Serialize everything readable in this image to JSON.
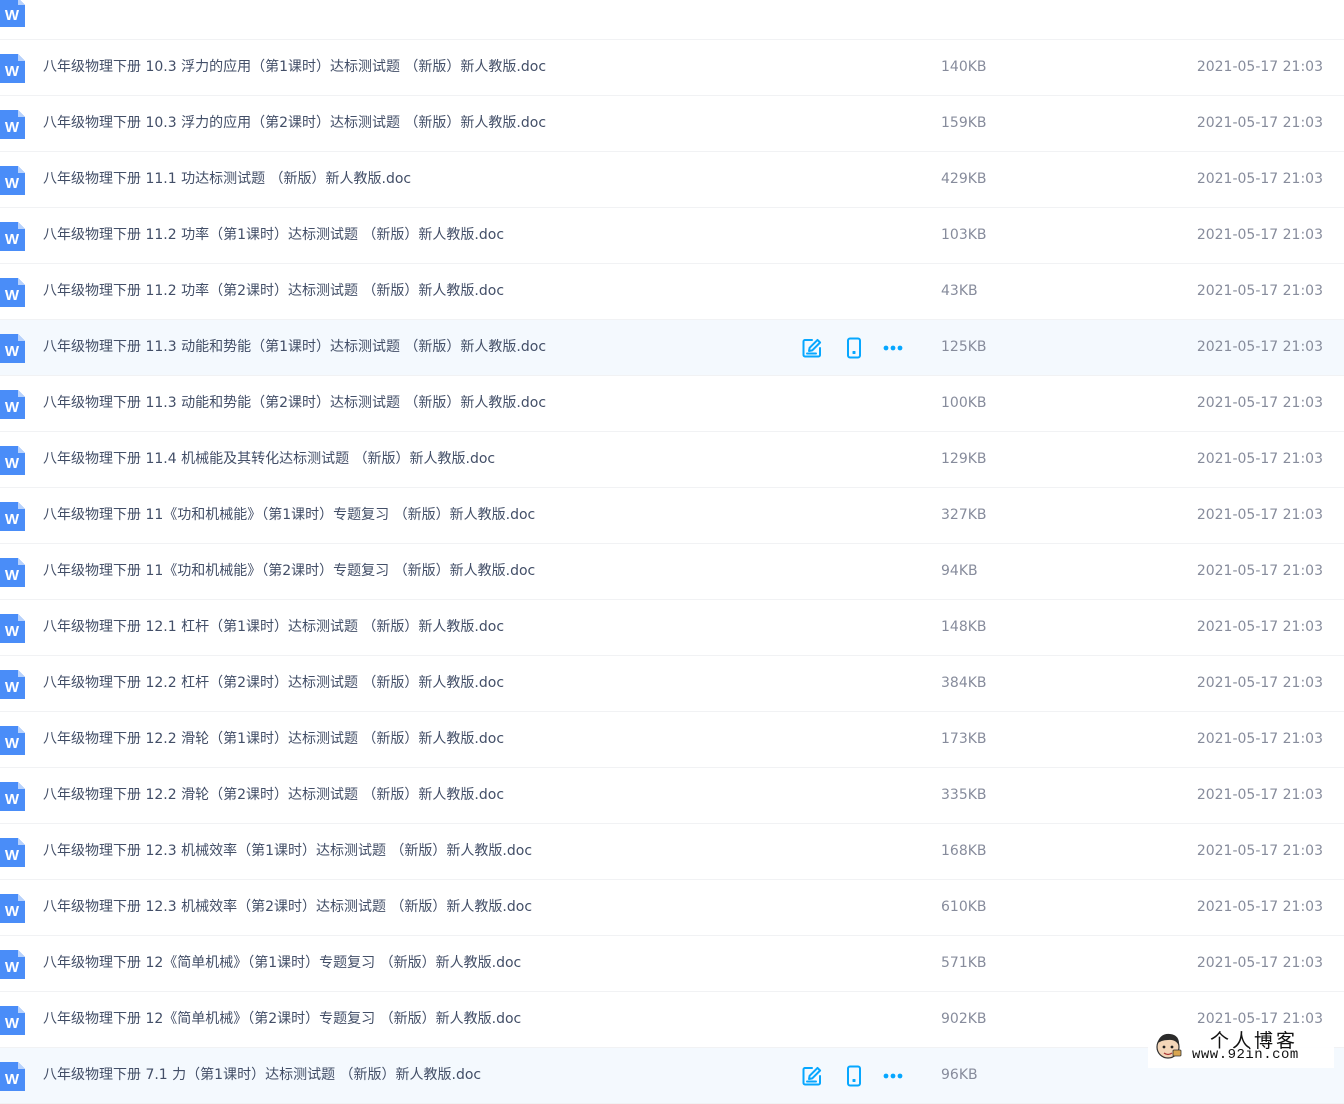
{
  "colors": {
    "row_text": "#424e67",
    "meta_text": "#878c9c",
    "hover_bg": "#f4f9fe",
    "icon_blue": "#4a8df8",
    "action_blue": "#06a7ff"
  },
  "files": [
    {
      "name": "",
      "size": "",
      "date": "",
      "hover": false,
      "icon": "word-doc-icon"
    },
    {
      "name": "八年级物理下册 10.3 浮力的应用（第1课时）达标测试题 （新版）新人教版.doc",
      "size": "140KB",
      "date": "2021-05-17 21:03",
      "hover": false,
      "icon": "word-doc-icon"
    },
    {
      "name": "八年级物理下册 10.3 浮力的应用（第2课时）达标测试题 （新版）新人教版.doc",
      "size": "159KB",
      "date": "2021-05-17 21:03",
      "hover": false,
      "icon": "word-doc-icon"
    },
    {
      "name": "八年级物理下册 11.1 功达标测试题 （新版）新人教版.doc",
      "size": "429KB",
      "date": "2021-05-17 21:03",
      "hover": false,
      "icon": "word-doc-icon"
    },
    {
      "name": "八年级物理下册 11.2 功率（第1课时）达标测试题 （新版）新人教版.doc",
      "size": "103KB",
      "date": "2021-05-17 21:03",
      "hover": false,
      "icon": "word-doc-icon"
    },
    {
      "name": "八年级物理下册 11.2 功率（第2课时）达标测试题 （新版）新人教版.doc",
      "size": "43KB",
      "date": "2021-05-17 21:03",
      "hover": false,
      "icon": "word-doc-icon"
    },
    {
      "name": "八年级物理下册 11.3 动能和势能（第1课时）达标测试题 （新版）新人教版.doc",
      "size": "125KB",
      "date": "2021-05-17 21:03",
      "hover": true,
      "icon": "word-doc-icon"
    },
    {
      "name": "八年级物理下册 11.3 动能和势能（第2课时）达标测试题 （新版）新人教版.doc",
      "size": "100KB",
      "date": "2021-05-17 21:03",
      "hover": false,
      "icon": "word-doc-icon"
    },
    {
      "name": "八年级物理下册 11.4 机械能及其转化达标测试题 （新版）新人教版.doc",
      "size": "129KB",
      "date": "2021-05-17 21:03",
      "hover": false,
      "icon": "word-doc-icon"
    },
    {
      "name": "八年级物理下册 11《功和机械能》（第1课时）专题复习 （新版）新人教版.doc",
      "size": "327KB",
      "date": "2021-05-17 21:03",
      "hover": false,
      "icon": "word-doc-icon"
    },
    {
      "name": "八年级物理下册 11《功和机械能》（第2课时）专题复习 （新版）新人教版.doc",
      "size": "94KB",
      "date": "2021-05-17 21:03",
      "hover": false,
      "icon": "word-doc-icon"
    },
    {
      "name": "八年级物理下册 12.1 杠杆（第1课时）达标测试题 （新版）新人教版.doc",
      "size": "148KB",
      "date": "2021-05-17 21:03",
      "hover": false,
      "icon": "word-doc-icon"
    },
    {
      "name": "八年级物理下册 12.2 杠杆（第2课时）达标测试题 （新版）新人教版.doc",
      "size": "384KB",
      "date": "2021-05-17 21:03",
      "hover": false,
      "icon": "word-doc-icon"
    },
    {
      "name": "八年级物理下册 12.2 滑轮（第1课时）达标测试题 （新版）新人教版.doc",
      "size": "173KB",
      "date": "2021-05-17 21:03",
      "hover": false,
      "icon": "word-doc-icon"
    },
    {
      "name": "八年级物理下册 12.2 滑轮（第2课时）达标测试题 （新版）新人教版.doc",
      "size": "335KB",
      "date": "2021-05-17 21:03",
      "hover": false,
      "icon": "word-doc-icon"
    },
    {
      "name": "八年级物理下册 12.3 机械效率（第1课时）达标测试题 （新版）新人教版.doc",
      "size": "168KB",
      "date": "2021-05-17 21:03",
      "hover": false,
      "icon": "word-doc-icon"
    },
    {
      "name": "八年级物理下册 12.3 机械效率（第2课时）达标测试题 （新版）新人教版.doc",
      "size": "610KB",
      "date": "2021-05-17 21:03",
      "hover": false,
      "icon": "word-doc-icon"
    },
    {
      "name": "八年级物理下册 12《简单机械》（第1课时）专题复习 （新版）新人教版.doc",
      "size": "571KB",
      "date": "2021-05-17 21:03",
      "hover": false,
      "icon": "word-doc-icon"
    },
    {
      "name": "八年级物理下册 12《简单机械》（第2课时）专题复习 （新版）新人教版.doc",
      "size": "902KB",
      "date": "2021-05-17 21:03",
      "hover": false,
      "icon": "word-doc-icon"
    },
    {
      "name": "八年级物理下册 7.1 力（第1课时）达标测试题 （新版）新人教版.doc",
      "size": "96KB",
      "date": "",
      "hover": true,
      "icon": "word-doc-icon"
    }
  ],
  "watermark": {
    "title": "个人博客",
    "url": "www.92in.com"
  }
}
